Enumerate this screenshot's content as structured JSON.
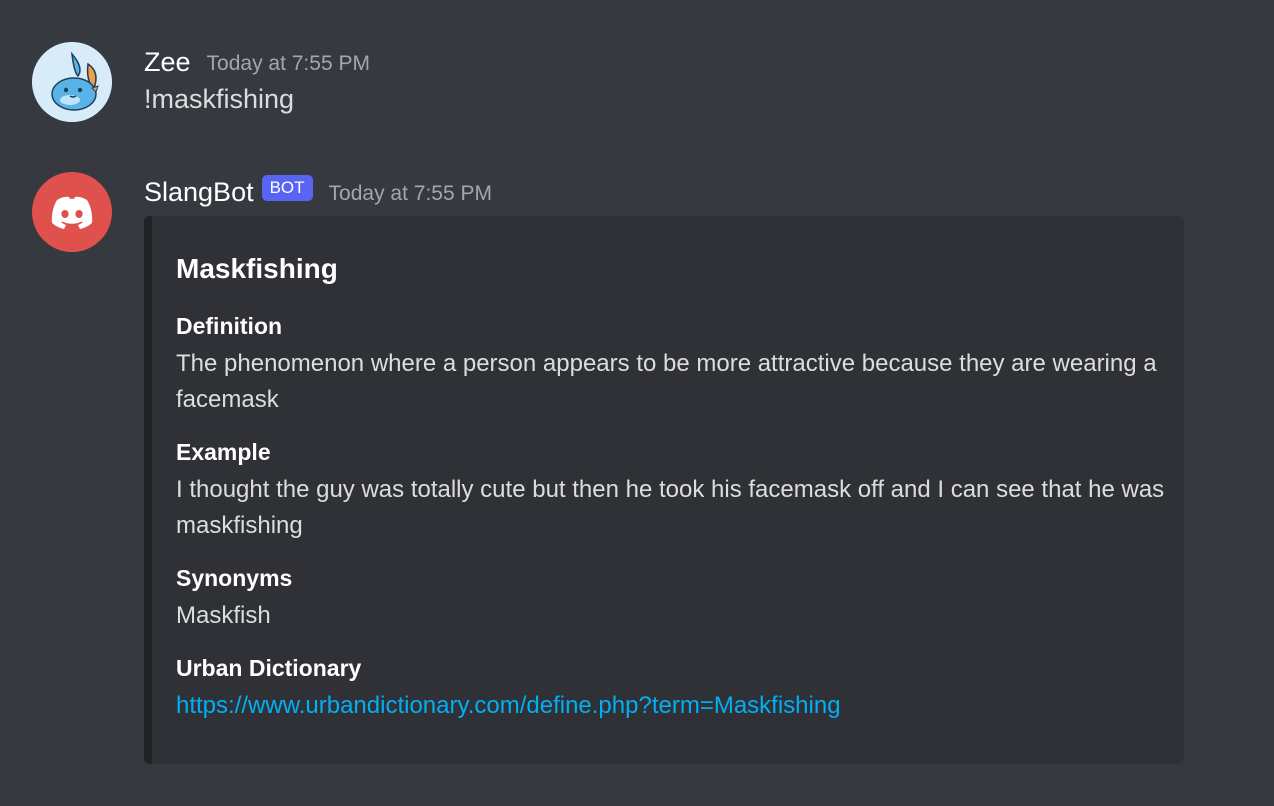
{
  "messages": [
    {
      "author": "Zee",
      "timestamp": "Today at 7:55 PM",
      "content": "!maskfishing",
      "avatar_icon": "mudkip-avatar-icon"
    },
    {
      "author": "SlangBot",
      "tag": "BOT",
      "timestamp": "Today at 7:55 PM",
      "avatar_icon": "discord-logo-icon",
      "embed": {
        "title": "Maskfishing",
        "fields": [
          {
            "name": "Definition",
            "value": "The phenomenon where a person appears to be more attractive because they are wearing a facemask"
          },
          {
            "name": "Example",
            "value": "I thought the guy was totally cute but then he took his facemask off and I can see that he was maskfishing"
          },
          {
            "name": "Synonyms",
            "value": "Maskfish"
          },
          {
            "name": "Urban Dictionary",
            "value": "https://www.urbandictionary.com/define.php?term=Maskfishing"
          }
        ]
      }
    }
  ],
  "colors": {
    "background": "#36393f",
    "embed_background": "#2f3136",
    "embed_border": "#202225",
    "bot_tag": "#5865f2",
    "link": "#00aff4",
    "bot_avatar": "#e0504d",
    "user_avatar": "#d7ecf8"
  }
}
